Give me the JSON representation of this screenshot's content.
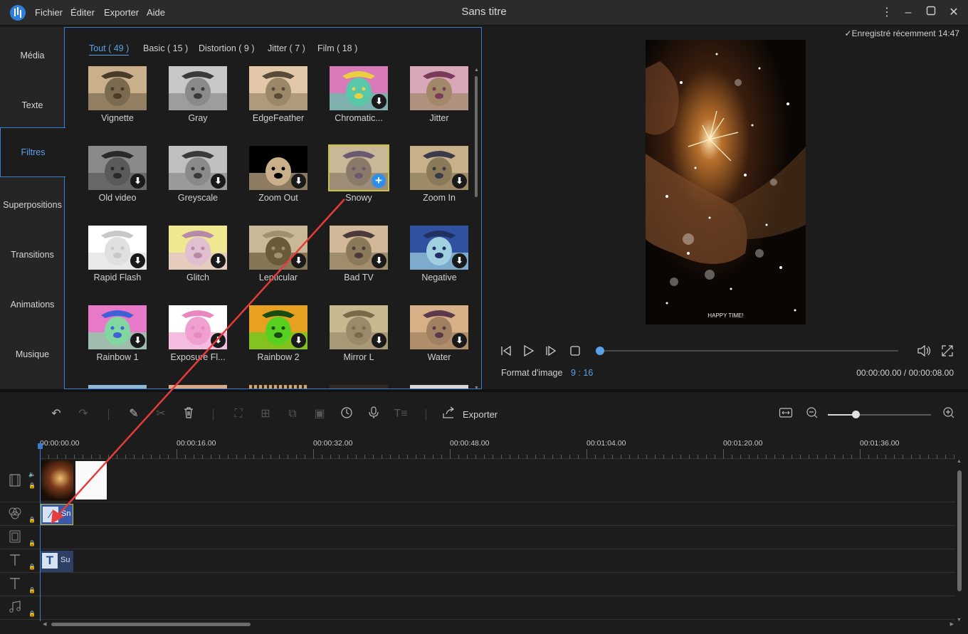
{
  "app": {
    "title": "Sans titre",
    "menu": [
      "Fichier",
      "Éditer",
      "Exporter",
      "Aide"
    ]
  },
  "sidebar": {
    "items": [
      "Média",
      "Texte",
      "Filtres",
      "Superpositions",
      "Transitions",
      "Animations",
      "Musique"
    ],
    "active": "Filtres"
  },
  "filters": {
    "tabs": [
      "Tout ( 49 )",
      "Basic ( 15 )",
      "Distortion ( 9 )",
      "Jitter ( 7 )",
      "Film ( 18 )"
    ],
    "active_tab": "Tout ( 49 )",
    "items": [
      {
        "label": "Vignette",
        "badge": ""
      },
      {
        "label": "Gray",
        "badge": ""
      },
      {
        "label": "EdgeFeather",
        "badge": ""
      },
      {
        "label": "Chromatic...",
        "badge": "download"
      },
      {
        "label": "Jitter",
        "badge": ""
      },
      {
        "label": "Old video",
        "badge": "download"
      },
      {
        "label": "Greyscale",
        "badge": "download"
      },
      {
        "label": "Zoom Out",
        "badge": "download"
      },
      {
        "label": "Snowy",
        "badge": "add",
        "selected": true
      },
      {
        "label": "Zoom In",
        "badge": "download"
      },
      {
        "label": "Rapid Flash",
        "badge": "download"
      },
      {
        "label": "Glitch",
        "badge": "download"
      },
      {
        "label": "Lenticular",
        "badge": "download"
      },
      {
        "label": "Bad TV",
        "badge": "download"
      },
      {
        "label": "Negative",
        "badge": "download"
      },
      {
        "label": "Rainbow 1",
        "badge": "download"
      },
      {
        "label": "Exposure Fl...",
        "badge": "download"
      },
      {
        "label": "Rainbow 2",
        "badge": "download"
      },
      {
        "label": "Mirror L",
        "badge": "download"
      },
      {
        "label": "Water",
        "badge": "download"
      }
    ]
  },
  "preview": {
    "saved_status": "Enregistré récemment 14:47",
    "video_caption": "HAPPY TIME!",
    "ratio_label": "Format d'image",
    "ratio_value": "9 : 16",
    "timecode": "00:00:00.00 / 00:00:08.00",
    "playback_progress": 0
  },
  "toolbar": {
    "export_label": "Exporter",
    "zoom_level": 0.27
  },
  "timeline": {
    "ticks": [
      "00:00:00.00",
      "00:00:16.00",
      "00:00:32.00",
      "00:00:48.00",
      "00:01:04.00",
      "00:01:20.00",
      "00:01:36.00"
    ],
    "filter_clip_label": "Sn",
    "text_clip_label": "Su"
  },
  "colors": {
    "accent": "#5ca0e8",
    "panel_border": "#3a7ccd",
    "annotation_arrow": "#e83b3b",
    "selection": "#c8c040"
  }
}
